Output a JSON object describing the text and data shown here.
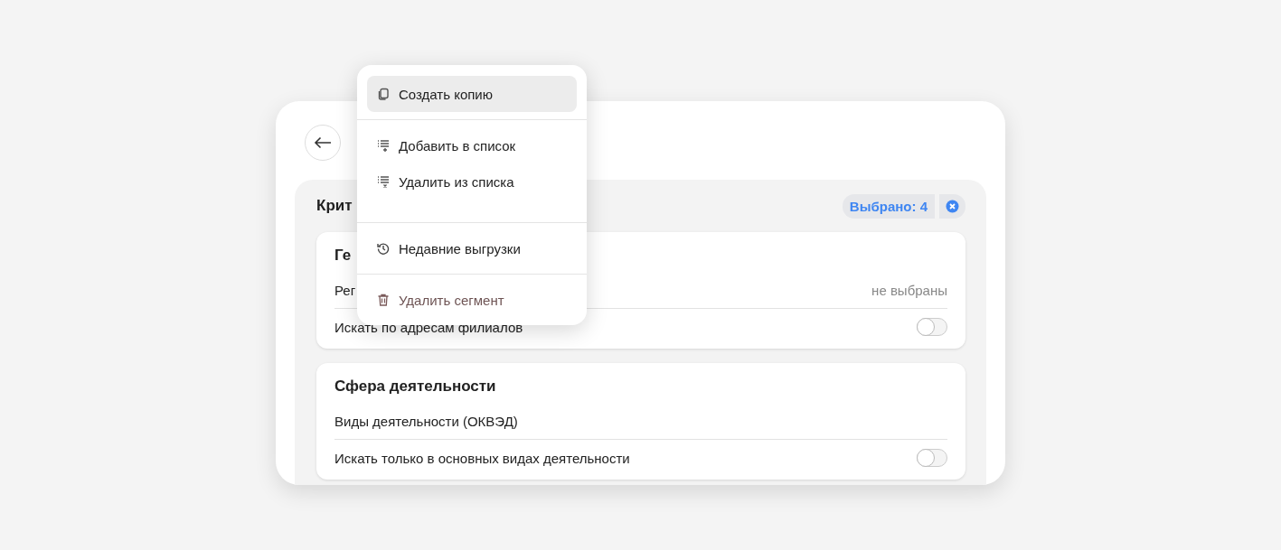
{
  "panel": {
    "title": "Крит",
    "selected_badge": "Выбрано: 4"
  },
  "sections": [
    {
      "title": "Ге",
      "rows": [
        {
          "kind": "select",
          "label": "Рег",
          "value": "не выбраны"
        },
        {
          "kind": "toggle",
          "label": "Искать по адресам филиалов",
          "on": false
        }
      ]
    },
    {
      "title": "Сфера деятельности",
      "rows": [
        {
          "kind": "select",
          "label": "Виды деятельности (ОКВЭД)"
        },
        {
          "kind": "toggle",
          "label": "Искать только в основных видах деятельности",
          "on": false
        }
      ]
    }
  ],
  "menu": {
    "groups": [
      [
        {
          "kind": "copy",
          "label": "Создать копию",
          "selected": true,
          "destructive": false
        }
      ],
      [
        {
          "kind": "list-add",
          "label": "Добавить в список",
          "selected": false,
          "destructive": false
        },
        {
          "kind": "list-remove",
          "label": "Удалить из списка",
          "selected": false,
          "destructive": false
        }
      ],
      [
        {
          "kind": "history",
          "label": "Недавние выгрузки",
          "selected": false,
          "destructive": false
        }
      ],
      [
        {
          "kind": "trash",
          "label": "Удалить сегмент",
          "selected": false,
          "destructive": true
        }
      ]
    ]
  }
}
